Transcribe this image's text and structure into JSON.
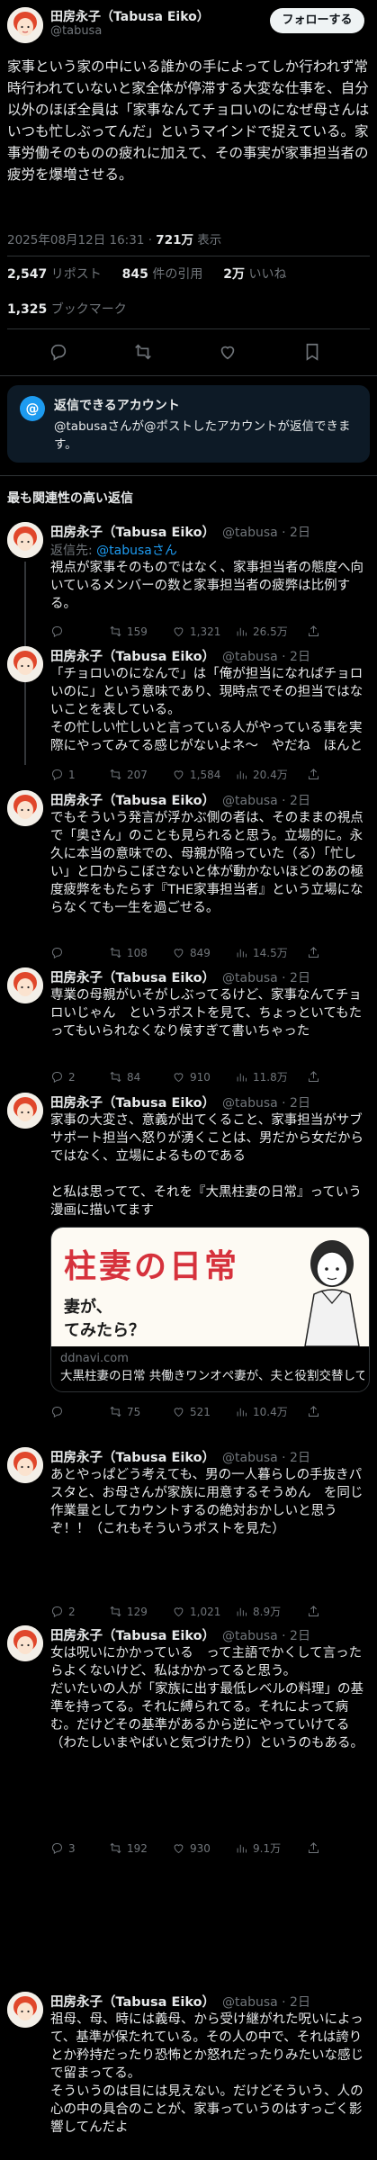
{
  "author": {
    "name": "田房永子（Tabusa Eiko）",
    "handle": "@tabusa",
    "follow_label": "フォローする"
  },
  "main_post": {
    "text": "家事という家の中にいる誰かの手によってしか行われず常時行われていないと家全体が停滞する大変な仕事を、自分以外のほぼ全員は「家事なんてチョロいのになぜ母さんはいつも忙しぶってんだ」というマインドで捉えている。家事労働そのものの疲れに加えて、その事実が家事担当者の疲労を爆増させる。",
    "timestamp": "2025年08月12日 16:31 · ",
    "views_count": "721万",
    "views_label": " 表示",
    "reposts_count": "2,547",
    "reposts_label": " リポスト",
    "quotes_count": "845",
    "quotes_label": " 件の引用",
    "likes_count": "2万",
    "likes_label": " いいね",
    "bookmarks_count": "1,325",
    "bookmarks_label": " ブックマーク"
  },
  "reply_restriction": {
    "title": "返信できるアカウント",
    "text": "@tabusaさんが@ポストしたアカウントが返信できます。"
  },
  "sort_label": "最も関連性の高い返信",
  "replies": [
    {
      "name": "田房永子（Tabusa Eiko）",
      "handle": "@tabusa · 2日",
      "reply_to_prefix": "返信先: ",
      "reply_to_handle": "@tabusaさん",
      "text": "視点が家事そのものではなく、家事担当者の態度へ向いているメンバーの数と家事担当者の疲弊は比例する。",
      "replies": "",
      "reposts": "159",
      "likes": "1,321",
      "views": "26.5万"
    },
    {
      "name": "田房永子（Tabusa Eiko）",
      "handle": "@tabusa · 2日",
      "text": "「チョロいのになんで」は「俺が担当になればチョロいのに」という意味であり、現時点でその担当ではないことを表している。\nその忙しい忙しいと言っている人がやっている事を実際にやってみてる感じがないよネ〜　やだね　ほんと",
      "replies": "1",
      "reposts": "207",
      "likes": "1,584",
      "views": "20.4万"
    },
    {
      "name": "田房永子（Tabusa Eiko）",
      "handle": "@tabusa · 2日",
      "text": "でもそういう発言が浮かぶ側の者は、そのままの視点で「奥さん」のことも見られると思う。立場的に。永久に本当の意味での、母親が陥っていた（る）「忙しい」と口からこぼさないと体が動かないほどのあの極度疲弊をもたらす『THE家事担当者』という立場にならなくても一生を過ごせる。",
      "replies": "",
      "reposts": "108",
      "likes": "849",
      "views": "14.5万"
    },
    {
      "name": "田房永子（Tabusa Eiko）",
      "handle": "@tabusa · 2日",
      "text": "専業の母親がいそがしぶってるけど、家事なんてチョロいじゃん　というポストを見て、ちょっといてもたってもいられなくなり候すぎて書いちゃった",
      "replies": "2",
      "reposts": "84",
      "likes": "910",
      "views": "11.8万"
    },
    {
      "name": "田房永子（Tabusa Eiko）",
      "handle": "@tabusa · 2日",
      "text": "家事の大変さ、意義が出てくること、家事担当がサブサポート担当へ怒りが湧くことは、男だから女だからではなく、立場によるものである\n\nと私は思ってて、それを『大黒柱妻の日常』っていう漫画に描いてます",
      "card_banner": "柱妻の日常",
      "card_sub1": "妻が、",
      "card_sub2": "てみたら？",
      "card_domain": "ddnavi.com",
      "card_title": "大黒柱妻の日常 共働きワンオペ妻が、夫と役割交替してみたら？| 連載 | ダ・ヴィンチ…",
      "replies": "",
      "reposts": "75",
      "likes": "521",
      "views": "10.4万"
    },
    {
      "name": "田房永子（Tabusa Eiko）",
      "handle": "@tabusa · 2日",
      "text": "あとやっぱどう考えても、男の一人暮らしの手抜きパスタと、お母さんが家族に用意するそうめん　を同じ作業量としてカウントするの絶対おかしいと思うぞ！！（これもそういうポストを見た）",
      "replies": "2",
      "reposts": "129",
      "likes": "1,021",
      "views": "8.9万"
    },
    {
      "name": "田房永子（Tabusa Eiko）",
      "handle": "@tabusa · 2日",
      "text": "女は呪いにかかっている　って主語でかくして言ったらよくないけど、私はかかってると思う。\nだいたいの人が「家族に出す最低レベルの料理」の基準を持ってる。それに縛られてる。それによって病む。だけどその基準があるから逆にやっていけてる（わたしいまやばいと気づけたり）というのもある。",
      "replies": "3",
      "reposts": "192",
      "likes": "930",
      "views": "9.1万"
    },
    {
      "name": "田房永子（Tabusa Eiko）",
      "handle": "@tabusa · 2日",
      "text": "祖母、母、時には義母、から受け継がれた呪いによって、基準が保たれている。その人の中で、それは誇りとか矜持だったり恐怖とか怒れだったりみたいな感じで留まってる。\nそういうのは目には見えない。だけどそういう、人の心の中の具合のことが、家事っていうのはすっごく影響してんだよ"
    }
  ],
  "colors": {
    "background": "#000000",
    "text": "#e7e9ea",
    "muted": "#71767b",
    "link": "#1d9bf0",
    "divider": "#2f3336",
    "notice_bg": "#0d1a26"
  },
  "icons": [
    "reply-icon",
    "repost-icon",
    "like-icon",
    "views-icon",
    "bookmark-icon",
    "share-icon",
    "at-icon",
    "verified-icon"
  ]
}
